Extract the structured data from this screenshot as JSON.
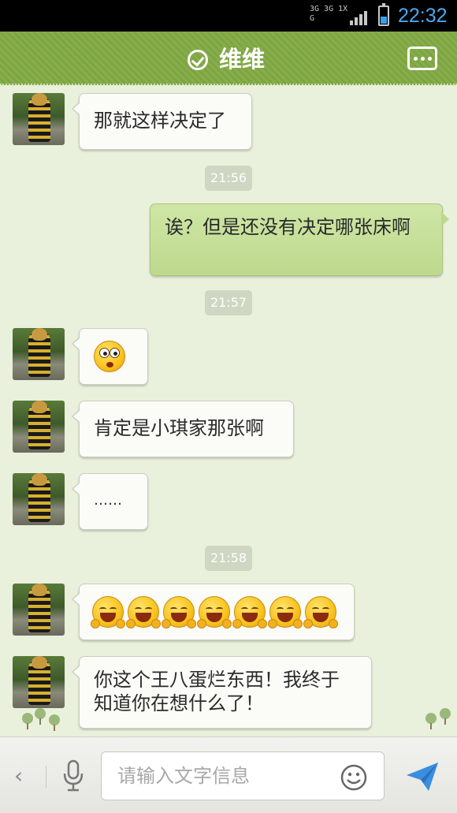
{
  "status_bar": {
    "network": "3G 3G 1X G",
    "time": "22:32",
    "battery_level": 0.35,
    "signal_bars": 4
  },
  "header": {
    "title": "维维",
    "verified_icon": "check-circle-icon",
    "more_icon": "more-options-icon"
  },
  "messages": [
    {
      "side": "left",
      "type": "text",
      "text": "那就这样决定了"
    },
    {
      "type": "time",
      "text": "21:56"
    },
    {
      "side": "right",
      "type": "text",
      "text": "诶？但是还没有决定哪张床啊"
    },
    {
      "type": "time",
      "text": "21:57"
    },
    {
      "side": "left",
      "type": "emoji",
      "emoji": "shocked-face-icon"
    },
    {
      "side": "left",
      "type": "text",
      "text": "肯定是小琪家那张啊"
    },
    {
      "side": "left",
      "type": "text",
      "text": "……"
    },
    {
      "type": "time",
      "text": "21:58"
    },
    {
      "side": "left",
      "type": "emoji-row",
      "emoji": "laughing-face-icon",
      "count": 7
    },
    {
      "side": "left",
      "type": "text",
      "text": "你这个王八蛋烂东西！我终于知道你在想什么了！"
    }
  ],
  "input_bar": {
    "back_icon": "chevron-left-icon",
    "mic_icon": "microphone-icon",
    "placeholder": "请输入文字信息",
    "value": "",
    "emoji_icon": "smiley-icon",
    "send_icon": "send-icon"
  },
  "colors": {
    "header_green": "#7ea444",
    "chat_bg": "#e9f0dc",
    "outgoing_bubble": "#bdd98d",
    "incoming_bubble": "#fbfbf8",
    "clock_blue": "#4aa8ee"
  }
}
